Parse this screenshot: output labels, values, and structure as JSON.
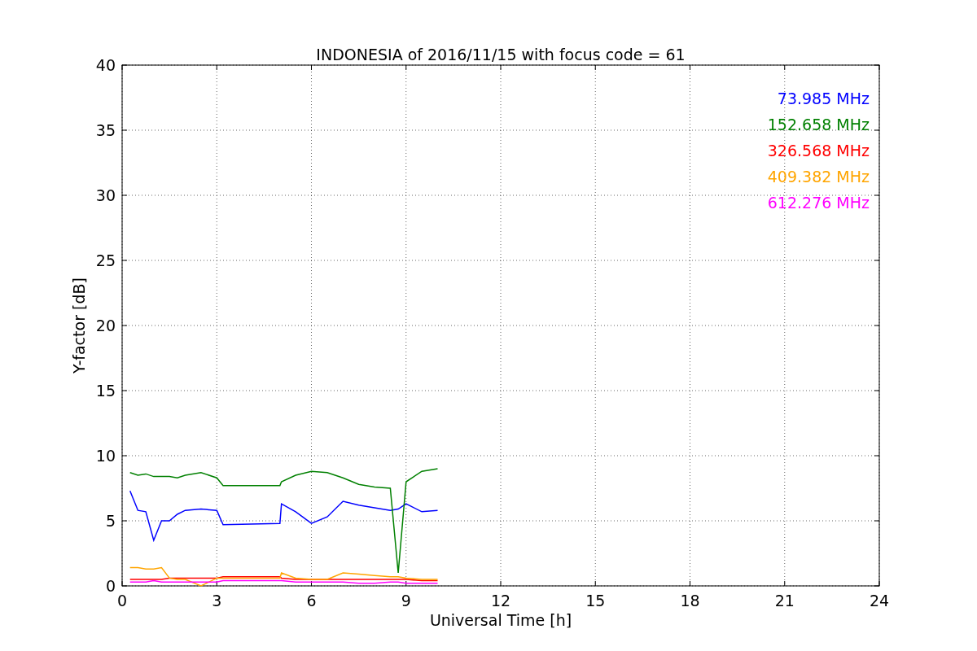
{
  "chart_data": {
    "type": "line",
    "title": "INDONESIA of 2016/11/15 with focus code = 61",
    "xlabel": "Universal Time [h]",
    "ylabel": "Y-factor [dB]",
    "x": [
      0.25,
      0.5,
      0.75,
      1,
      1.25,
      1.5,
      1.75,
      2,
      2.5,
      3,
      3.2,
      5,
      5.05,
      5.5,
      6,
      6.5,
      7,
      7.5,
      8,
      8.5,
      8.75,
      9,
      9.5,
      10
    ],
    "series": [
      {
        "name": "73.985 MHz",
        "color": "#0000ff",
        "values": [
          7.3,
          5.8,
          5.7,
          3.5,
          5.0,
          5.0,
          5.5,
          5.8,
          5.9,
          5.8,
          4.7,
          4.8,
          6.3,
          5.7,
          4.8,
          5.3,
          6.5,
          6.2,
          6.0,
          5.8,
          5.9,
          6.3,
          5.7,
          5.8
        ]
      },
      {
        "name": "152.658 MHz",
        "color": "#008000",
        "values": [
          8.7,
          8.5,
          8.6,
          8.4,
          8.4,
          8.4,
          8.3,
          8.5,
          8.7,
          8.3,
          7.7,
          7.7,
          8.0,
          8.5,
          8.8,
          8.7,
          8.3,
          7.8,
          7.6,
          7.5,
          1.0,
          8.0,
          8.8,
          9.0
        ]
      },
      {
        "name": "326.568 MHz",
        "color": "#ff0000",
        "values": [
          0.5,
          0.5,
          0.5,
          0.5,
          0.5,
          0.6,
          0.6,
          0.6,
          0.6,
          0.6,
          0.7,
          0.7,
          0.6,
          0.5,
          0.5,
          0.5,
          0.5,
          0.5,
          0.5,
          0.5,
          0.5,
          0.5,
          0.4,
          0.4
        ]
      },
      {
        "name": "409.382 MHz",
        "color": "#ffa500",
        "values": [
          1.4,
          1.4,
          1.3,
          1.3,
          1.4,
          0.6,
          0.5,
          0.5,
          0.0,
          0.6,
          0.6,
          0.6,
          1.0,
          0.6,
          0.5,
          0.5,
          1.0,
          0.9,
          0.8,
          0.7,
          0.7,
          0.6,
          0.5,
          0.5
        ]
      },
      {
        "name": "612.276 MHz",
        "color": "#ff00ff",
        "values": [
          0.3,
          0.3,
          0.3,
          0.4,
          0.3,
          0.3,
          0.3,
          0.3,
          0.3,
          0.3,
          0.4,
          0.4,
          0.4,
          0.3,
          0.3,
          0.3,
          0.3,
          0.2,
          0.2,
          0.3,
          0.3,
          0.2,
          0.2,
          0.2
        ]
      }
    ],
    "grid": true,
    "xlim": [
      0,
      24
    ],
    "ylim": [
      0,
      40
    ],
    "xticks": [
      0,
      3,
      6,
      9,
      12,
      15,
      18,
      21,
      24
    ],
    "yticks": [
      0,
      5,
      10,
      15,
      20,
      25,
      30,
      35,
      40
    ]
  }
}
